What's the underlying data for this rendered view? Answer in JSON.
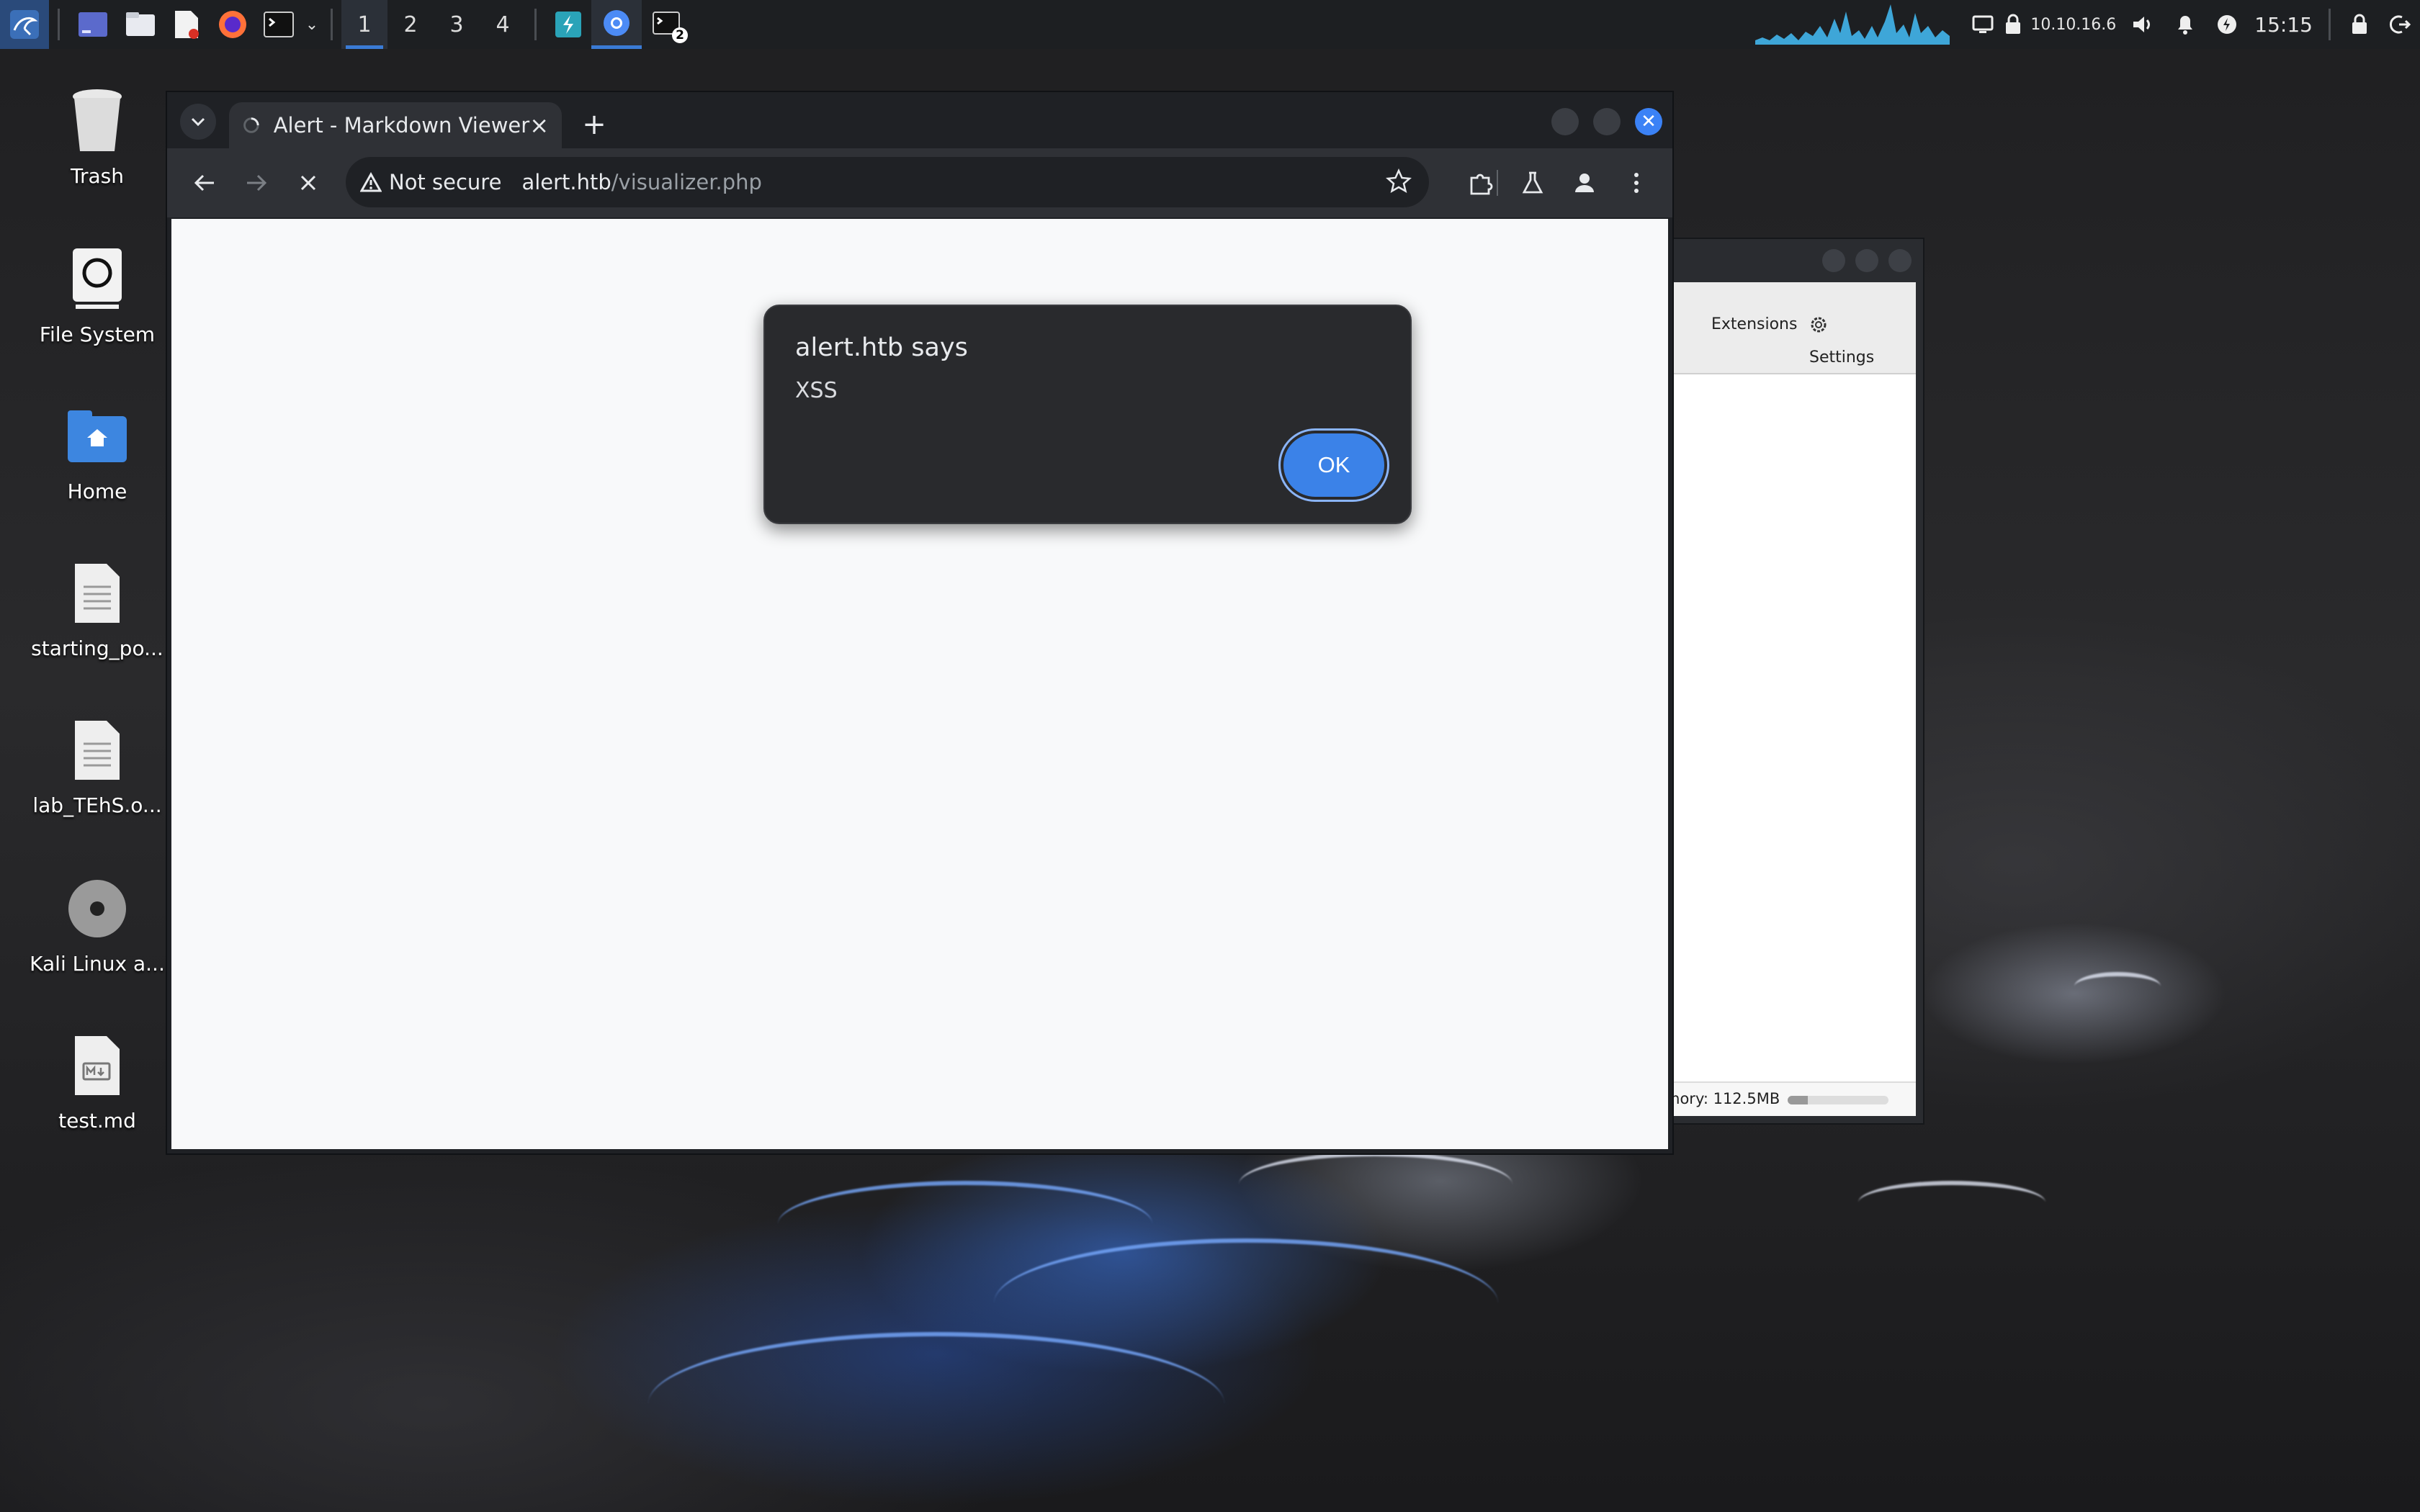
{
  "panel": {
    "workspaces": [
      "1",
      "2",
      "3",
      "4"
    ],
    "terminal_badge": "2",
    "ip": "10.10.16.6",
    "clock": "15:15"
  },
  "desktop": {
    "icons": [
      {
        "label": "Trash"
      },
      {
        "label": "File System"
      },
      {
        "label": "Home"
      },
      {
        "label": "starting_po..."
      },
      {
        "label": "lab_TEhS.o..."
      },
      {
        "label": "Kali Linux a..."
      },
      {
        "label": "test.md"
      }
    ]
  },
  "bg_window": {
    "extensions": "Extensions",
    "settings": "Settings",
    "memory": "mory: 112.5MB",
    "memory_bar_fraction": 0.2
  },
  "browser": {
    "tab_title": "Alert - Markdown Viewer",
    "not_secure": "Not secure",
    "url_host": "alert.htb",
    "url_path": "/visualizer.php"
  },
  "dialog": {
    "title": "alert.htb says",
    "message": "XSS",
    "ok_label": "OK"
  },
  "colors": {
    "accent": "#3b82e8",
    "panel": "#1d1f22",
    "chrome_dark": "#2f3136"
  }
}
